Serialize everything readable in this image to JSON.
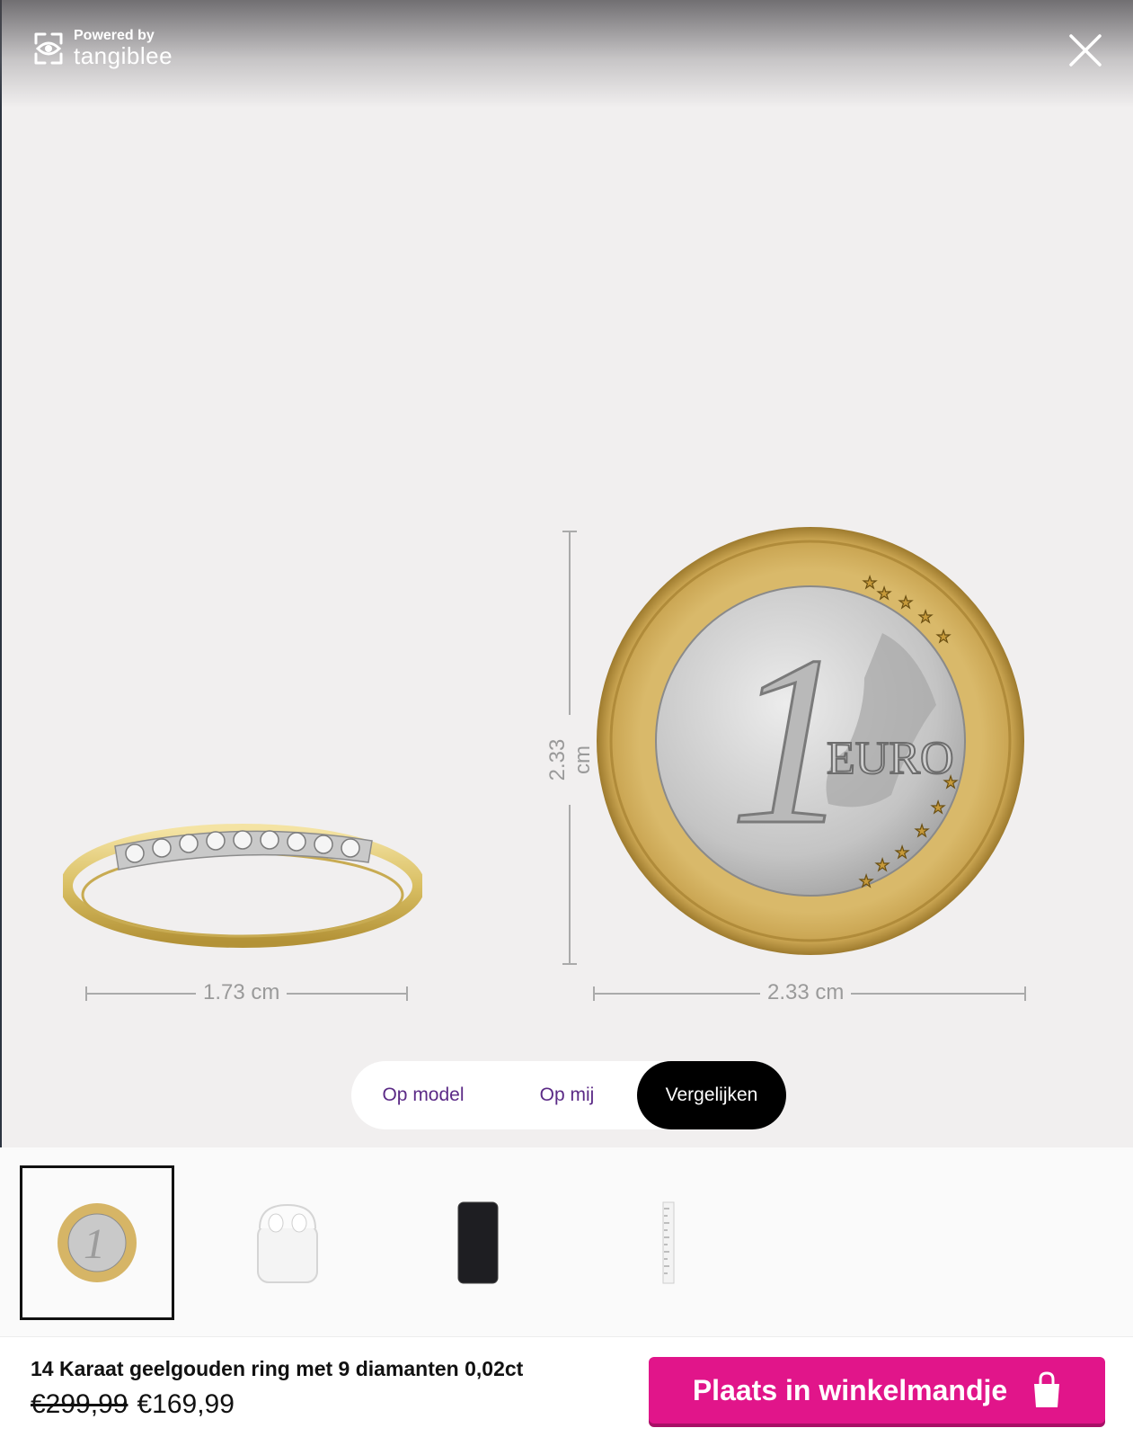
{
  "brand": {
    "powered_by": "Powered by",
    "name": "tangiblee"
  },
  "measurements": {
    "ring_width": "1.73 cm",
    "coin_height": "2.33 cm",
    "coin_width": "2.33 cm"
  },
  "coin": {
    "numeral": "1",
    "text": "EURO"
  },
  "tabs": [
    {
      "label": "Op model",
      "active": false
    },
    {
      "label": "Op mij",
      "active": false
    },
    {
      "label": "Vergelijken",
      "active": true
    }
  ],
  "thumbnails": [
    {
      "icon": "euro-coin-icon",
      "selected": true
    },
    {
      "icon": "earbuds-case-icon",
      "selected": false
    },
    {
      "icon": "smartphone-icon",
      "selected": false
    },
    {
      "icon": "ruler-icon",
      "selected": false
    }
  ],
  "product": {
    "title": "14 Karaat geelgouden ring met 9 diamanten 0,02ct",
    "price_old": "€299,99",
    "price_new": "€169,99"
  },
  "cart": {
    "label": "Plaats in winkelmandje"
  },
  "colors": {
    "accent": "#e1158a",
    "tab_text": "#5b2a86",
    "background": "#f1efef"
  }
}
